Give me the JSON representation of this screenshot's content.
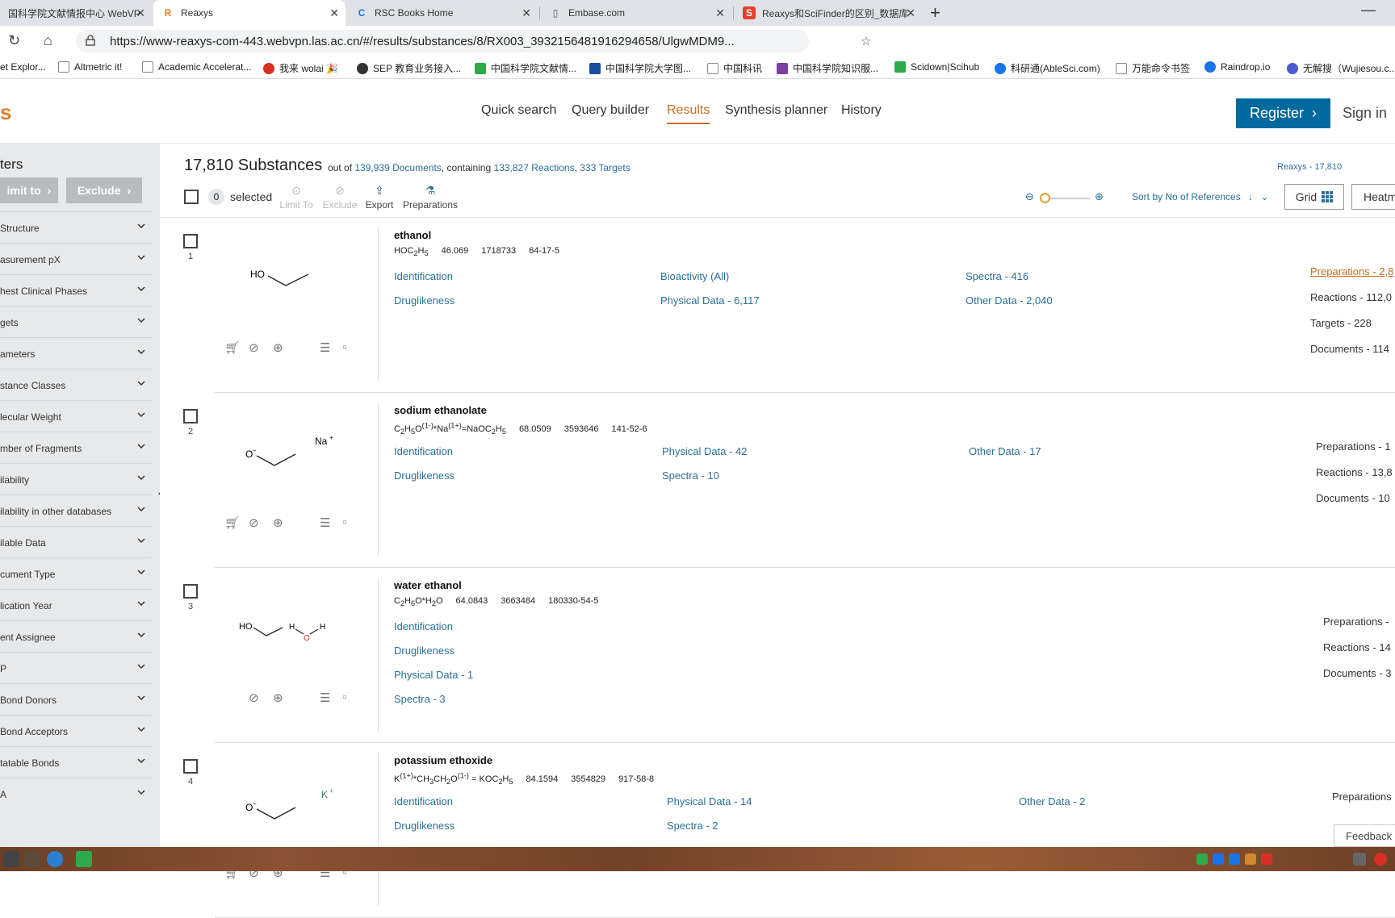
{
  "browser": {
    "tabs": [
      {
        "label": "国科学院文献情报中心 WebVP",
        "icon": "webvpn-icon"
      },
      {
        "label": "Reaxys",
        "icon": "reaxys-icon"
      },
      {
        "label": "RSC Books Home",
        "icon": "rsc-icon"
      },
      {
        "label": "Embase.com",
        "icon": "page-icon"
      },
      {
        "label": "Reaxys和SciFinder的区别_数据库",
        "icon": "sogou-icon"
      }
    ],
    "url": "https://www-reaxys-com-443.webvpn.las.ac.cn/#/results/substances/8/RX003_3932156481916294658/UlgwMDM9...",
    "bookmarks": [
      {
        "label": "et Explor...",
        "color": "#1a73e8"
      },
      {
        "label": "Altmetric it!",
        "color": "#aaaaaa"
      },
      {
        "label": "Academic Accelerat...",
        "color": "#aaaaaa"
      },
      {
        "label": "我来 wolai 🎉",
        "color": "#d93025"
      },
      {
        "label": "SEP 教育业务接入...",
        "color": "#333333"
      },
      {
        "label": "中国科学院文献情...",
        "color": "#2eaa4a"
      },
      {
        "label": "中国科学院大学图...",
        "color": "#1a4fa0"
      },
      {
        "label": "中国科讯",
        "color": "#aaaaaa"
      },
      {
        "label": "中国科学院知识服...",
        "color": "#7b3fa0"
      },
      {
        "label": "Scidown|Scihub",
        "color": "#2eaa4a"
      },
      {
        "label": "科研通(AbleSci.com)",
        "color": "#1a73e8"
      },
      {
        "label": "万能命令书签",
        "color": "#aaaaaa"
      },
      {
        "label": "Raindrop.io",
        "color": "#1a73e8"
      },
      {
        "label": "无解搜（Wujiesou.c...",
        "color": "#4b5bd0"
      }
    ]
  },
  "header": {
    "logo": "s",
    "nav": [
      {
        "label": "Quick search",
        "active": false
      },
      {
        "label": "Query builder",
        "active": false
      },
      {
        "label": "Results",
        "active": true
      },
      {
        "label": "Synthesis planner",
        "active": false
      },
      {
        "label": "History",
        "active": false
      }
    ],
    "register": "Register",
    "signin": "Sign in"
  },
  "sidebar": {
    "title": "ters",
    "limit": "imit to",
    "exclude": "Exclude",
    "filters": [
      "Structure",
      "asurement pX",
      "hest Clinical Phases",
      "gets",
      "ameters",
      "stance Classes",
      "lecular Weight",
      "mber of Fragments",
      "ilability",
      "ilability in other databases",
      "ilable Data",
      "cument Type",
      "lication Year",
      "ent Assignee",
      "P",
      "Bond Donors",
      "Bond Acceptors",
      "tatable Bonds",
      "A"
    ]
  },
  "results": {
    "count": "17,810 Substances",
    "out_of": "out of",
    "documents": "139,939 Documents",
    "containing": ", containing",
    "reactions": "133,827 Reactions",
    "targets": "333 Targets",
    "source": "Reaxys - 17,810",
    "selected_count": "0",
    "selected_label": "selected",
    "tools": [
      "Limit To",
      "Exclude",
      "Export",
      "Preparations"
    ],
    "sort": "Sort by No of References",
    "grid": "Grid",
    "heatmap": "Heatm"
  },
  "items": [
    {
      "num": "1",
      "name": "ethanol",
      "formula": "HOC<sub>2</sub>H<sub>5</sub>",
      "mw": "46.069",
      "rxid": "1718733",
      "cas": "64-17-5",
      "col1": [
        "Identification",
        "Druglikeness"
      ],
      "col2": [
        "Bioactivity (All)",
        "Physical Data - 6,117"
      ],
      "col3": [
        "Spectra - 416",
        "Other Data - 2,040"
      ],
      "side": [
        "Preparations - 2,8",
        "Reactions - 112,0",
        "Targets - 228",
        "Documents - 114"
      ]
    },
    {
      "num": "2",
      "name": "sodium ethanolate",
      "formula": "C<sub>2</sub>H<sub>5</sub>O<sup>(1-)</sup>*Na<sup>(1+)</sup>=NaOC<sub>2</sub>H<sub>5</sub>",
      "mw": "68.0509",
      "rxid": "3593646",
      "cas": "141-52-6",
      "col1": [
        "Identification",
        "Druglikeness"
      ],
      "col2": [
        "Physical Data - 42",
        "Spectra - 10"
      ],
      "col3": [
        "Other Data - 17"
      ],
      "side": [
        "Preparations - 1",
        "Reactions - 13,8",
        "Documents - 10"
      ]
    },
    {
      "num": "3",
      "name": "water ethanol",
      "formula": "C<sub>2</sub>H<sub>6</sub>O*H<sub>2</sub>O",
      "mw": "64.0843",
      "rxid": "3663484",
      "cas": "180330-54-5",
      "col1": [
        "Identification",
        "Druglikeness",
        "Physical Data - 1",
        "Spectra - 3"
      ],
      "col2": [],
      "col3": [],
      "side": [
        "Preparations -",
        "Reactions - 14",
        "Documents - 3"
      ]
    },
    {
      "num": "4",
      "name": "potassium ethoxide",
      "formula": "K<sup>(1+)</sup>*CH<sub>3</sub>CH<sub>2</sub>O<sup>(1-)</sup> = KOC<sub>2</sub>H<sub>5</sub>",
      "mw": "84.1594",
      "rxid": "3554829",
      "cas": "917-58-8",
      "col1": [
        "Identification",
        "Druglikeness"
      ],
      "col2": [
        "Physical Data - 14",
        "Spectra - 2"
      ],
      "col3": [
        "Other Data - 2"
      ],
      "side": [
        "Preparations"
      ]
    }
  ],
  "structures": [
    {
      "labels": [
        "HO"
      ]
    },
    {
      "labels": [
        "O",
        "−",
        "Na",
        "+"
      ]
    },
    {
      "labels": [
        "HO",
        "H",
        "O",
        "H"
      ]
    },
    {
      "labels": [
        "O",
        "−",
        "K",
        "+"
      ]
    }
  ],
  "feedback": "Feedback",
  "colors": {
    "accent": "#c96d1f",
    "link": "#2a6f97",
    "primary_button": "#00699e"
  }
}
